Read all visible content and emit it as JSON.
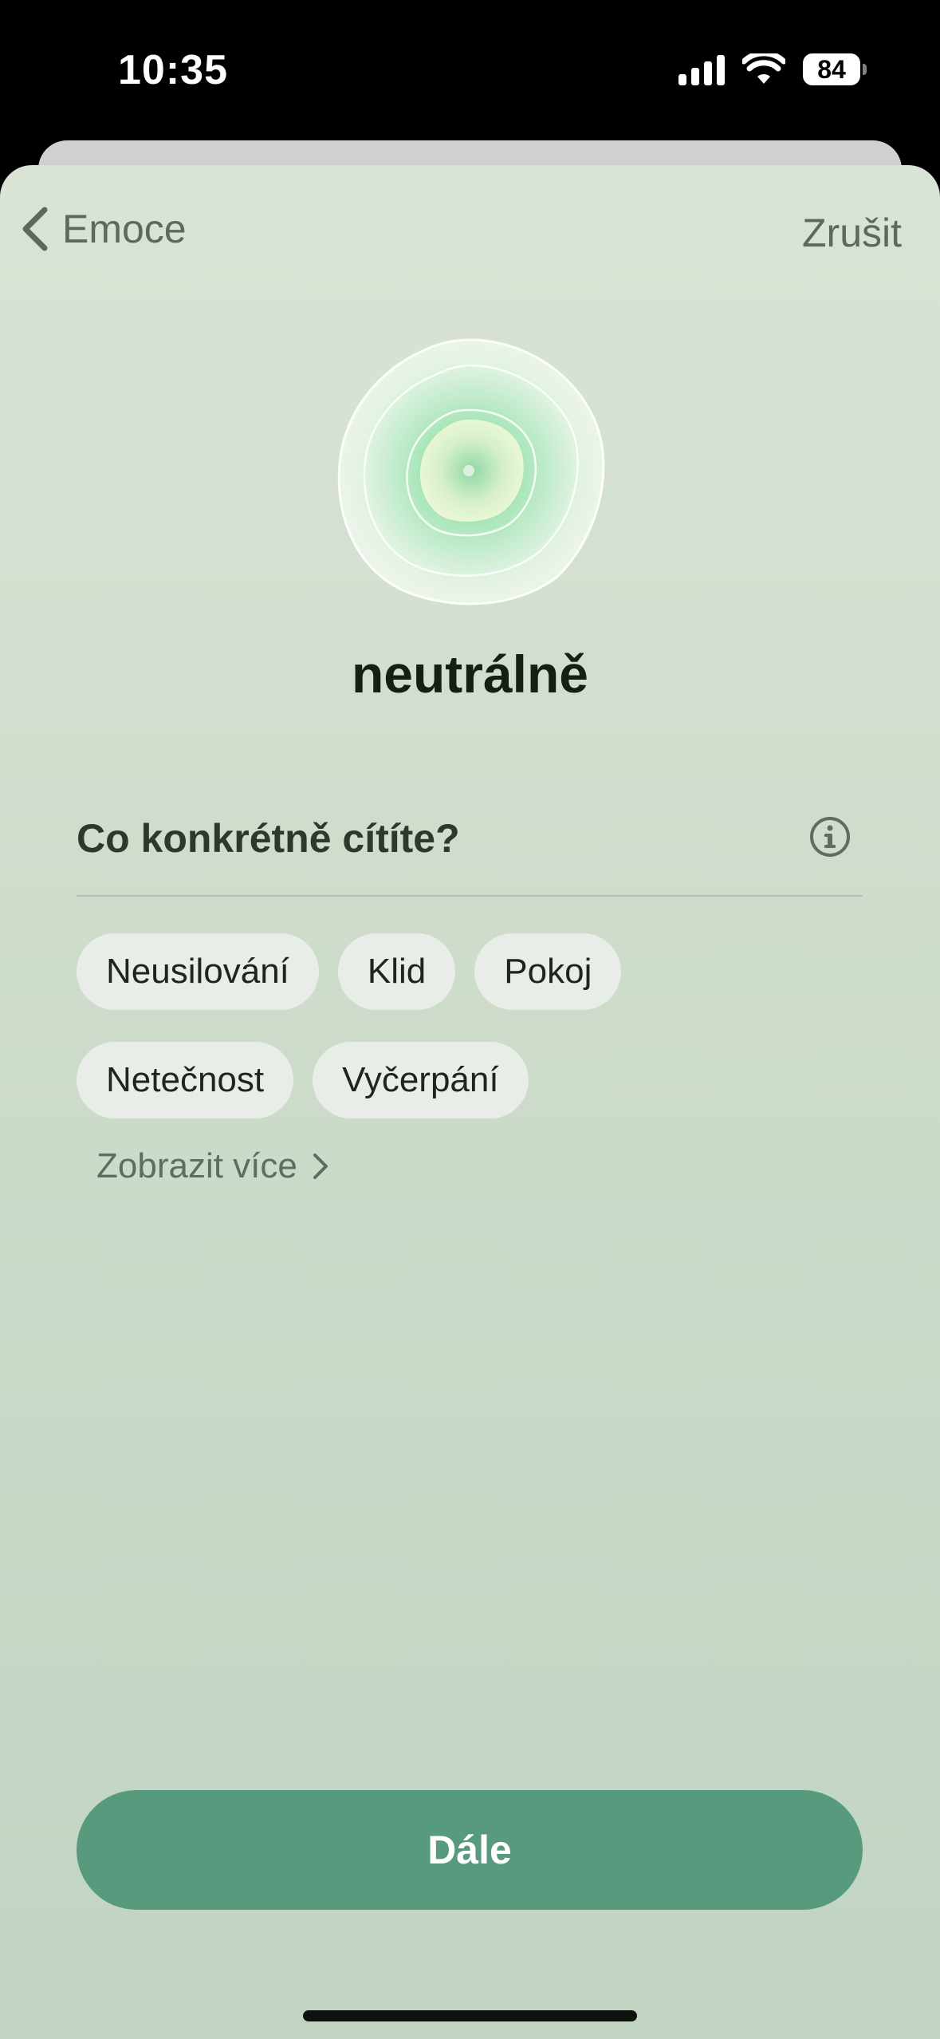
{
  "status_bar": {
    "time": "10:35",
    "battery": "84"
  },
  "nav": {
    "back_label": "Emoce",
    "cancel_label": "Zrušit"
  },
  "emotion": {
    "title": "neutrálně"
  },
  "question": {
    "label": "Co konkrétně cítíte?"
  },
  "chips": {
    "row1": [
      "Neusilování",
      "Klid",
      "Pokoj"
    ],
    "row2": [
      "Netečnost",
      "Vyčerpání"
    ]
  },
  "show_more": {
    "label": "Zobrazit více"
  },
  "primary_button": {
    "label": "Dále"
  },
  "colors": {
    "accent": "#589a7e",
    "chip_bg": "#e8eee7",
    "sheet_top": "#d9e4d6",
    "sheet_bottom": "#c1d4c3"
  }
}
